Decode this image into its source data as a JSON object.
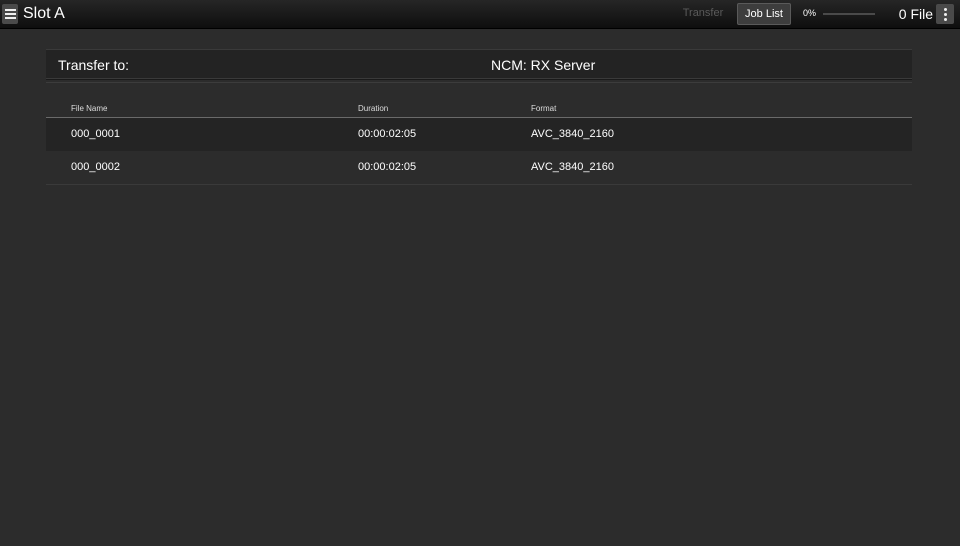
{
  "header": {
    "title": "Slot A",
    "transfer_label": "Transfer",
    "job_list_label": "Job List",
    "progress_text": "0%",
    "progress_value": 0,
    "file_count": "0 File",
    "menu_icon": "hamburger-icon",
    "more_icon": "kebab-icon"
  },
  "destination": {
    "label": "Transfer to:",
    "value": "NCM: RX Server"
  },
  "table": {
    "columns": [
      "File Name",
      "Duration",
      "Format"
    ],
    "rows": [
      {
        "name": "000_0001",
        "duration": "00:00:02:05",
        "format": "AVC_3840_2160"
      },
      {
        "name": "000_0002",
        "duration": "00:00:02:05",
        "format": "AVC_3840_2160"
      }
    ]
  },
  "colors": {
    "background": "#2c2c2c",
    "topbar": "#111111",
    "text": "#ffffff",
    "row_alt": "#242424"
  }
}
